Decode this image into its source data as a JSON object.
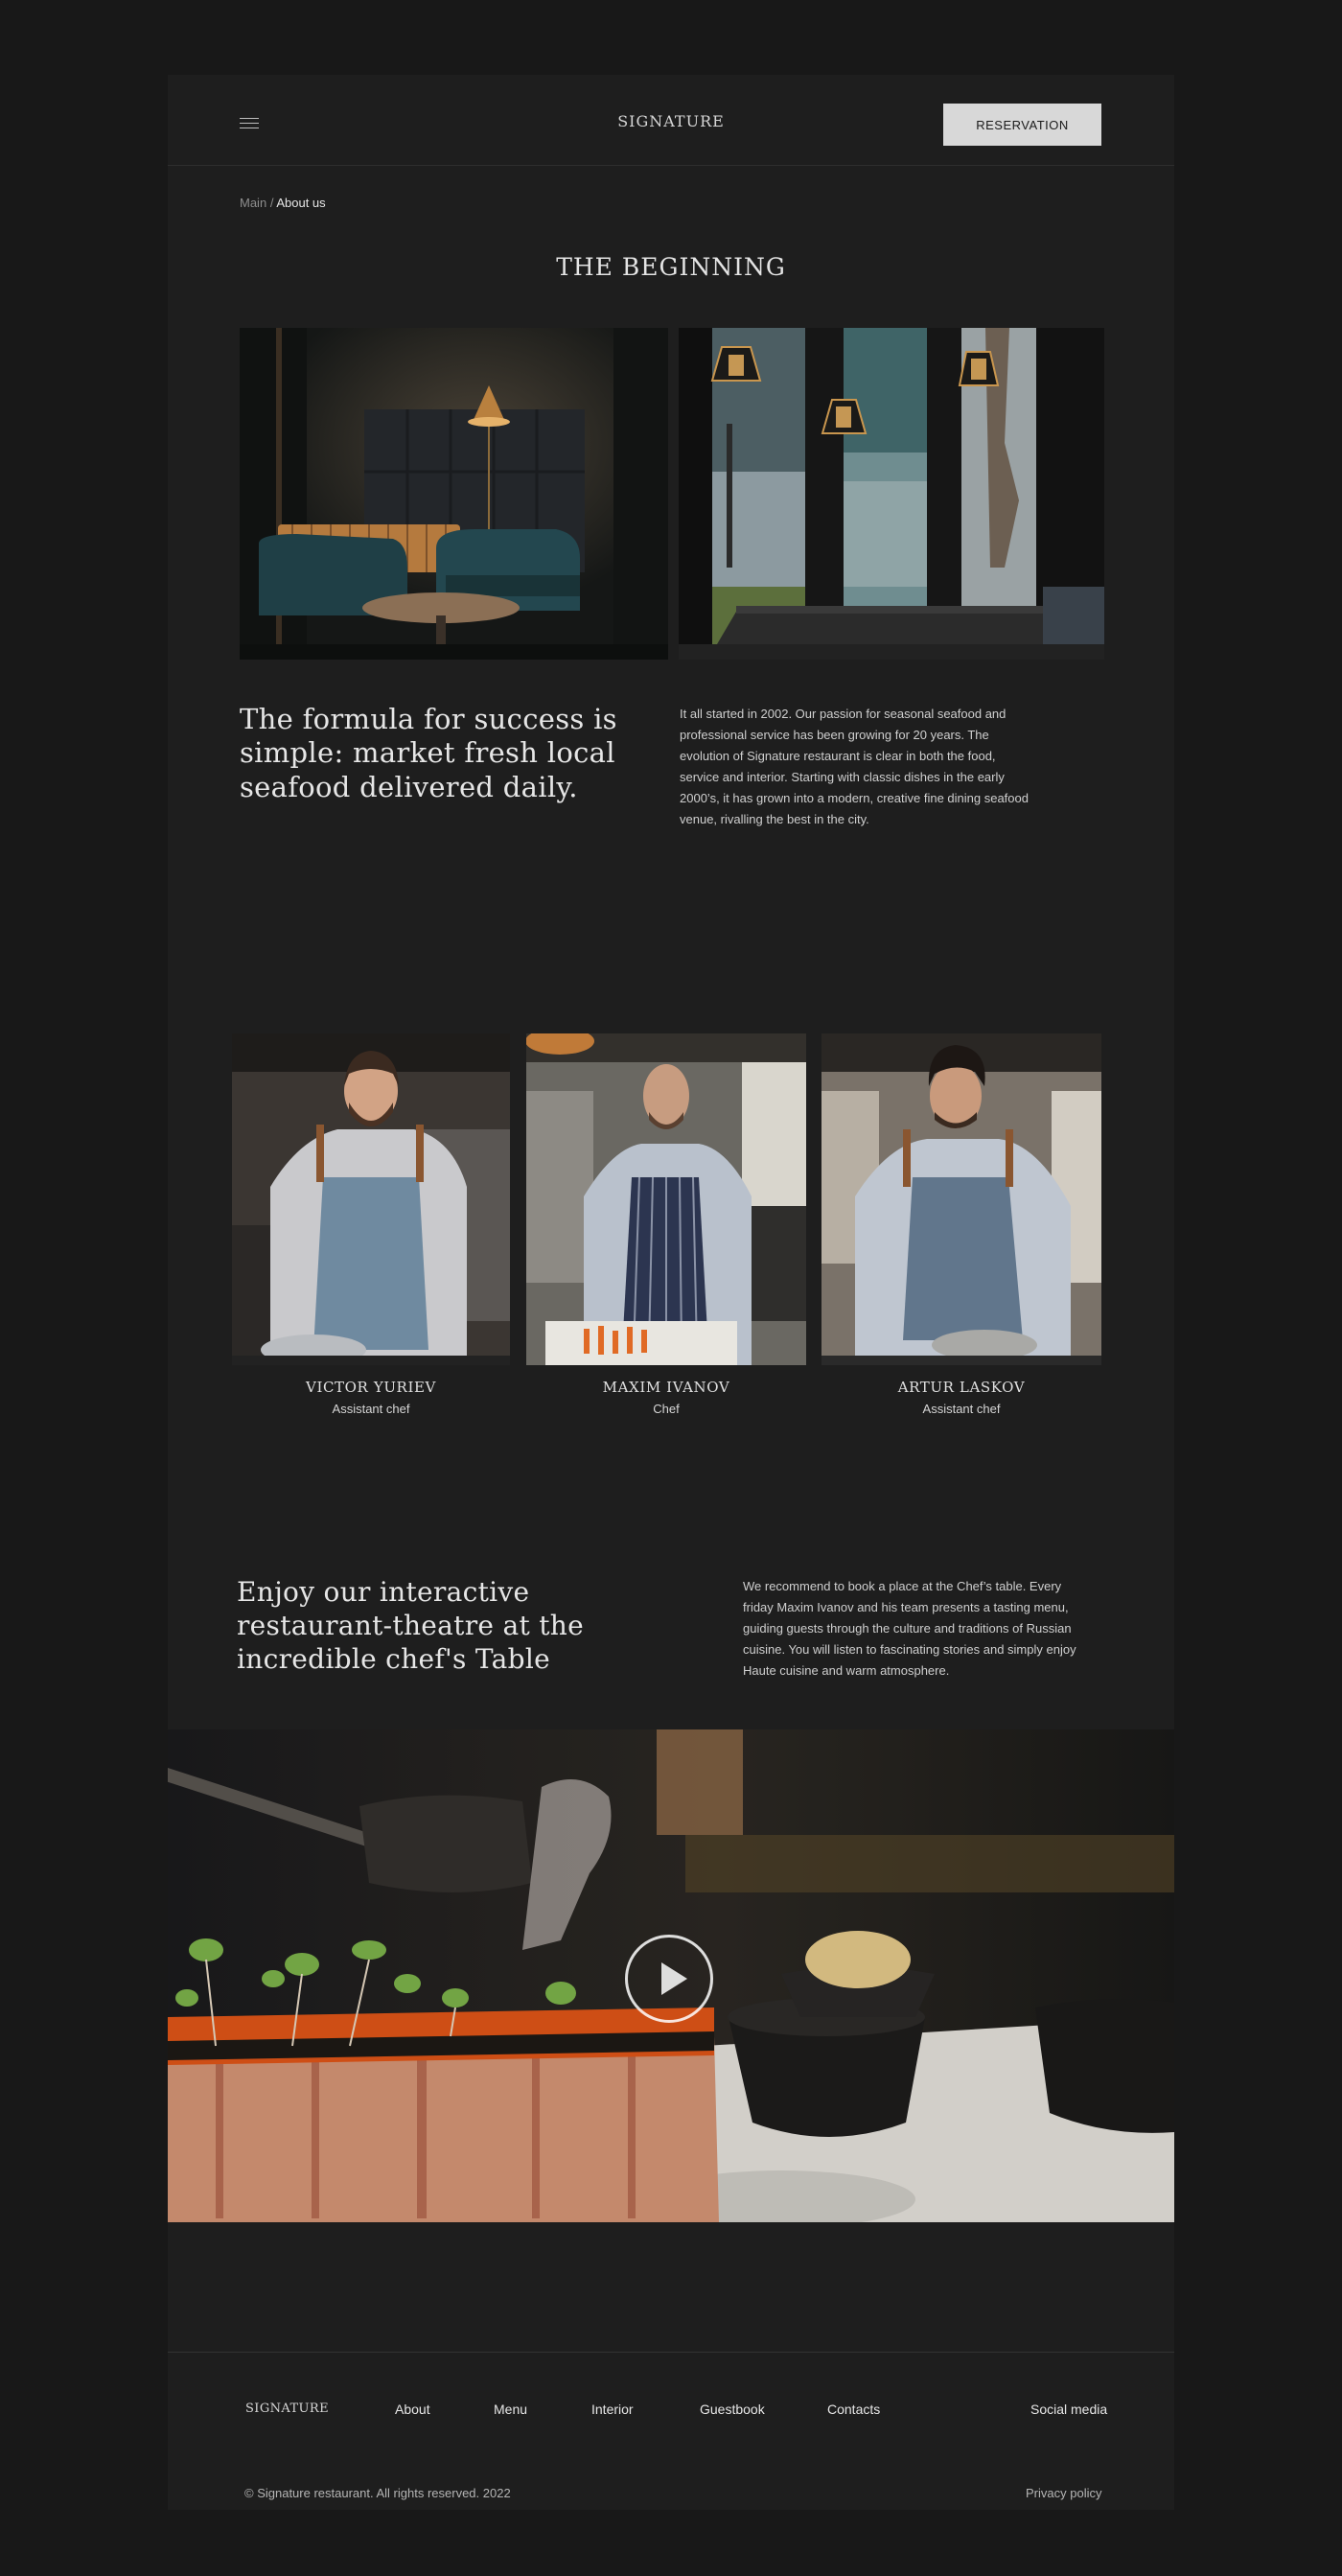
{
  "header": {
    "logo": "SIGNATURE",
    "reservation_label": "RESERVATION",
    "menu_icon": "hamburger-icon"
  },
  "breadcrumb": {
    "main": "Main",
    "separator": "/",
    "current": "About us"
  },
  "intro": {
    "title": "THE BEGINNING",
    "quote_line1": "The formula for success is",
    "quote_line2": "simple: market fresh local",
    "quote_line3": "seafood delivered daily.",
    "text_lines": [
      "It all started in 2002. Our passion for seasonal seafood and",
      "professional service has been growing for 20 years.  The",
      "evolution of Signature restaurant is clear in both the food,",
      "service and interior.  Starting with classic dishes in the early",
      "2000’s, it has grown into a modern, creative fine dining seafood",
      "venue, rivalling the best in the city."
    ]
  },
  "chefs": [
    {
      "name": "VICTOR YURIEV",
      "role": "Assistant chef"
    },
    {
      "name": "MAXIM IVANOV",
      "role": "Chef"
    },
    {
      "name": "ARTUR LASKOV",
      "role": "Assistant chef"
    }
  ],
  "chefs_table": {
    "heading_line1": "Enjoy our interactive",
    "heading_line2": "restaurant-theatre at the",
    "heading_line3": "incredible chef's Table",
    "text_lines": [
      "We recommend to book a place at the Chef’s table. Every",
      "friday Maxim Ivanov and his team presents a tasting menu,",
      "guiding guests through the culture and traditions of Russian",
      "cuisine. You will  listen to fascinating stories and simply enjoy",
      "Haute cuisine and warm atmosphere."
    ],
    "video_icon": "play-icon"
  },
  "footer": {
    "logo": "SIGNATURE",
    "links": [
      "About",
      "Menu",
      "Interior",
      "Guestbook",
      "Contacts"
    ],
    "social": "Social media",
    "copyright": "© Signature restaurant. All rights reserved. 2022",
    "privacy": "Privacy policy"
  }
}
